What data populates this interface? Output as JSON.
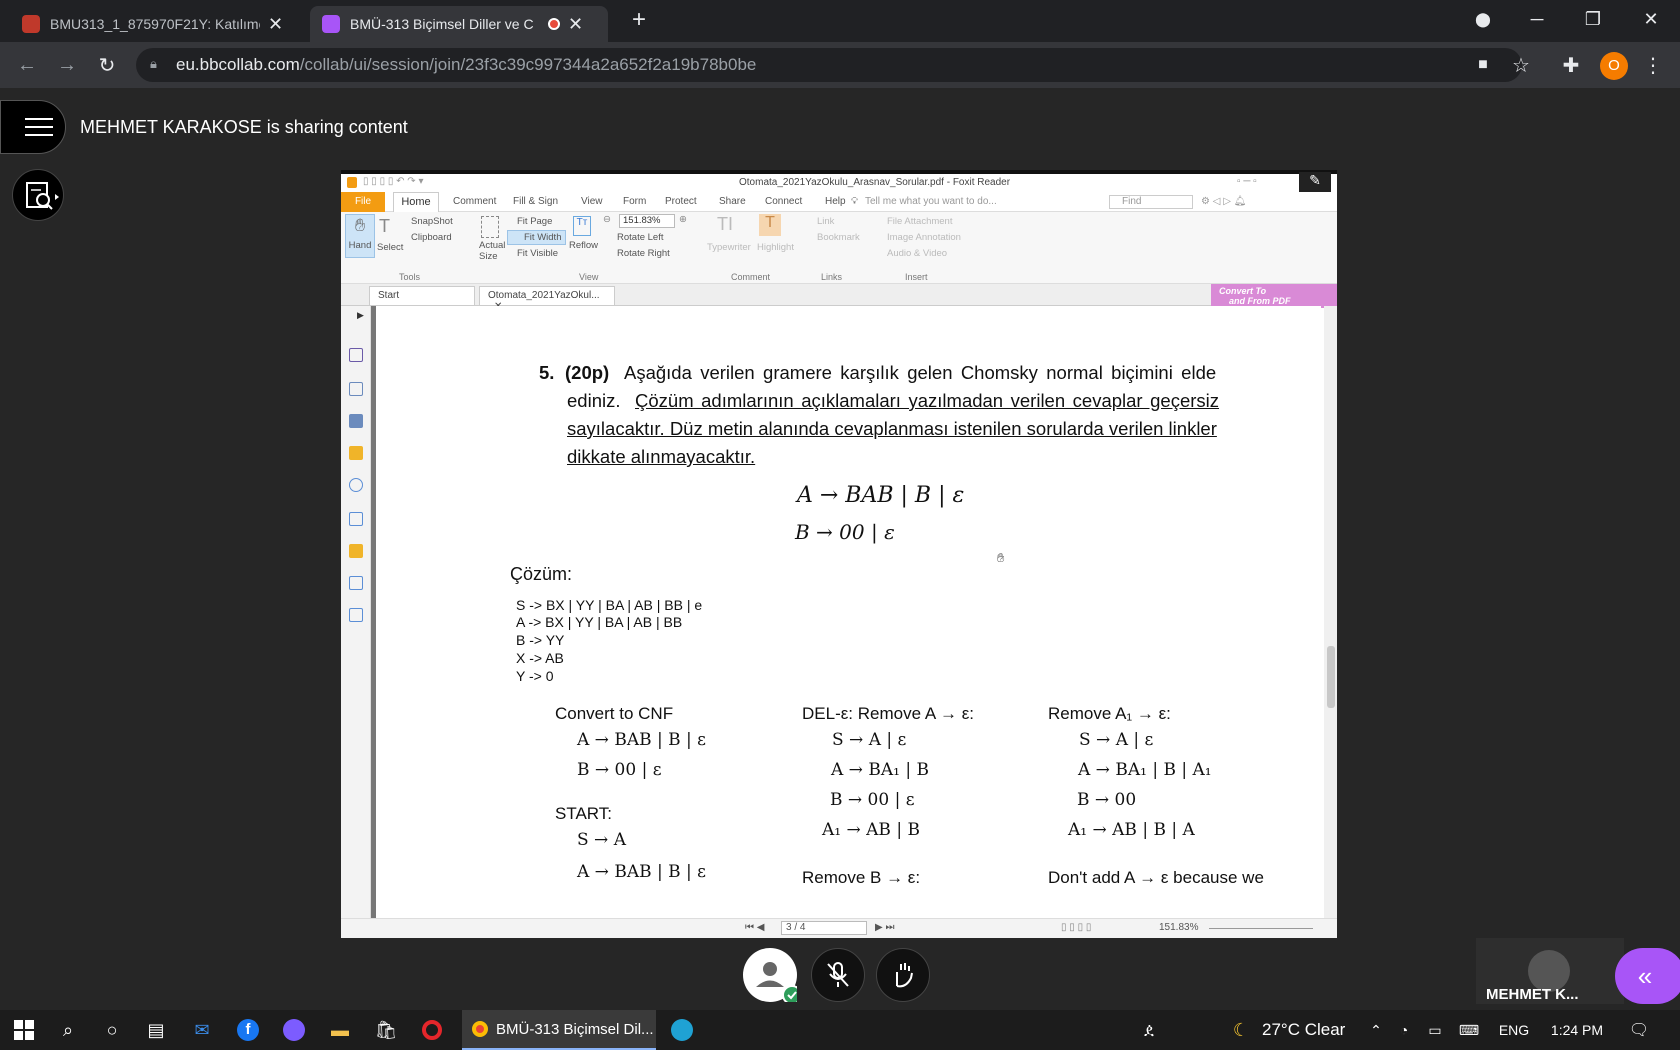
{
  "browser": {
    "tabs": [
      {
        "title": "BMU313_1_875970F21Y: Katılımc",
        "active": false
      },
      {
        "title": "BMÜ-313 Biçimsel Diller ve C",
        "active": true
      }
    ],
    "new_tab": "+",
    "url_host": "eu.bbcollab.com",
    "url_path": "/collab/ui/session/join/23f3c39c997344a2a652f2a19b78b0be",
    "profile_initial": "O"
  },
  "collab": {
    "sharing_text": "MEHMET KARAKOSE is sharing content",
    "participant_name": "MEHMET K..."
  },
  "foxit": {
    "window_title": "Otomata_2021YazOkulu_Arasnav_Sorular.pdf - Foxit Reader",
    "menu": [
      "File",
      "Home",
      "Comment",
      "Fill & Sign",
      "View",
      "Form",
      "Protect",
      "Share",
      "Connect",
      "Help"
    ],
    "tell_me": "Tell me what you want to do...",
    "find_placeholder": "Find",
    "ribbon": {
      "hand": "Hand",
      "select": "Select",
      "snapshot": "SnapShot",
      "clipboard": "Clipboard",
      "actual_size": "Actual Size",
      "fit_page": "Fit Page",
      "fit_width": "Fit Width",
      "fit_visible": "Fit Visible",
      "reflow": "Reflow",
      "zoom": "151.83%",
      "rotate_left": "Rotate Left",
      "rotate_right": "Rotate Right",
      "typewriter": "Typewriter",
      "highlight": "Highlight",
      "link": "Link",
      "bookmark": "Bookmark",
      "file_attachment": "File Attachment",
      "image_annotation": "Image Annotation",
      "audio_video": "Audio & Video",
      "groups": [
        "Tools",
        "View",
        "Comment",
        "Links",
        "Insert"
      ]
    },
    "doc_tabs": [
      "Start",
      "Otomata_2021YazOkul..."
    ],
    "convert": [
      "Convert To",
      "and From PDF"
    ],
    "page_indicator": "3 / 4",
    "status_zoom": "151.83%"
  },
  "document": {
    "q_num": "5.",
    "q_points": "(20p)",
    "q_line1": "Aşağıda verilen gramere karşılık gelen Chomsky normal biçimini elde",
    "q_line2a": "ediniz.",
    "q_line2b": "Çözüm adımlarının açıklamaları yazılmadan verilen cevaplar geçersiz",
    "q_line3": "sayılacaktır. Düz metin alanında cevaplanması istenilen sorularda verilen linkler",
    "q_line4": "dikkate alınmayacaktır.",
    "grammar1": "A → BAB | B | ε",
    "grammar2": "B → 00 | ε",
    "solution_label": "Çözüm:",
    "solution_rules": [
      "S -> BX | YY | BA | AB | BB | e",
      "A -> BX | YY | BA | AB | BB",
      "B -> YY",
      "X -> AB",
      "Y -> 0"
    ],
    "col1_title": "Convert to CNF",
    "col1_lines": [
      "A → BAB | B | ε",
      "B → 00 | ε"
    ],
    "col1_start": "START:",
    "col1_start_lines": [
      "S → A",
      "A → BAB | B | ε"
    ],
    "col2_title": "DEL-ε: Remove A → ε:",
    "col2_lines": [
      "S → A | ε",
      "A → BA₁ | B",
      "B → 00 | ε",
      "A₁ → AB | B"
    ],
    "col2_next": "Remove B → ε:",
    "col3_title": "Remove A₁ → ε:",
    "col3_lines": [
      "S → A | ε",
      "A → BA₁ | B | A₁",
      "B → 00",
      "A₁ → AB | B | A"
    ],
    "col3_next": "Don't add A → ε because we"
  },
  "taskbar": {
    "chrome_task": "BMÜ-313 Biçimsel Dil...",
    "weather": "27°C Clear",
    "lang": "ENG",
    "time": "1:24 PM"
  }
}
